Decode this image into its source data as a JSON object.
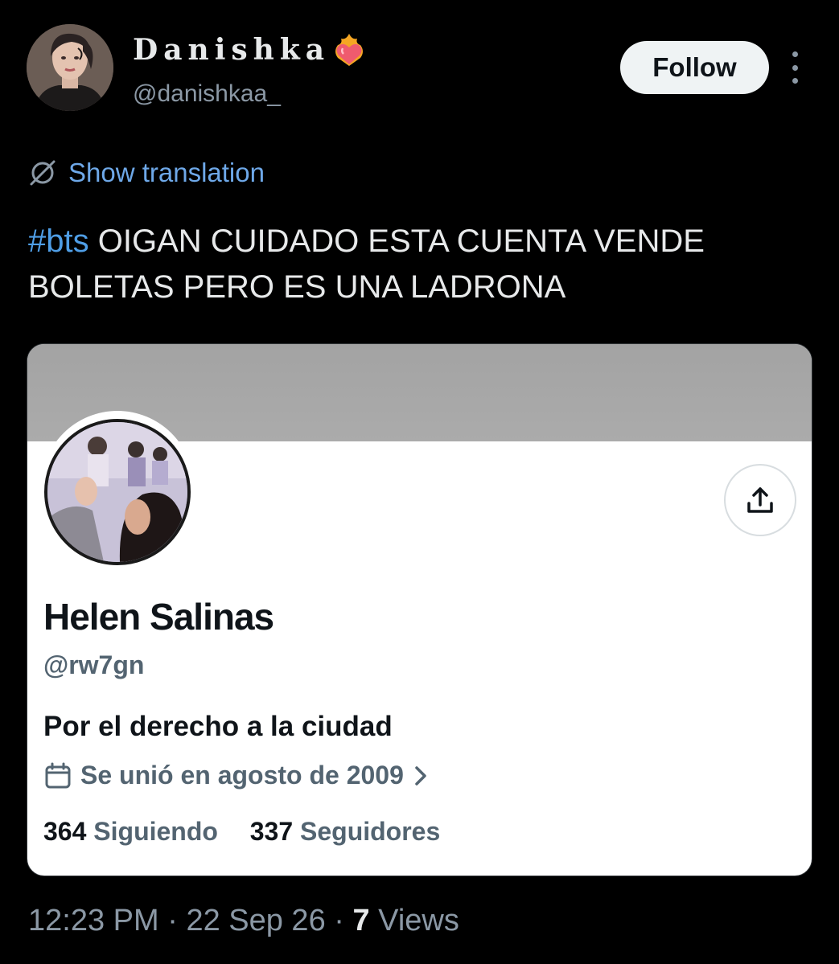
{
  "tweet": {
    "author": {
      "display_name": "Danishka",
      "handle": "@danishkaa_",
      "avatar_icon": "user-avatar",
      "name_emoji": "heart-on-fire-icon"
    },
    "follow_label": "Follow",
    "translation_label": "Show translation",
    "hashtag": "#bts",
    "text": " OIGAN CUIDADO ESTA CUENTA VENDE BOLETAS PERO ES UNA LADRONA",
    "meta": {
      "time": "12:23 PM",
      "sep1": " · ",
      "date": "22 Sep 26",
      "sep2": " · ",
      "views_count": "7",
      "views_label": " Views"
    }
  },
  "profile_card": {
    "name": "Helen Salinas",
    "handle": "@rw7gn",
    "bio": "Por el derecho a la ciudad",
    "joined": "Se unió en agosto de 2009",
    "following_count": "364",
    "following_label": "Siguiendo",
    "followers_count": "337",
    "followers_label": "Seguidores"
  },
  "colors": {
    "background": "#000000",
    "link_blue": "#4f9ee6",
    "secondary_text": "#8b98a5",
    "card_background": "#ffffff",
    "banner_gray": "#a7a7a7"
  }
}
